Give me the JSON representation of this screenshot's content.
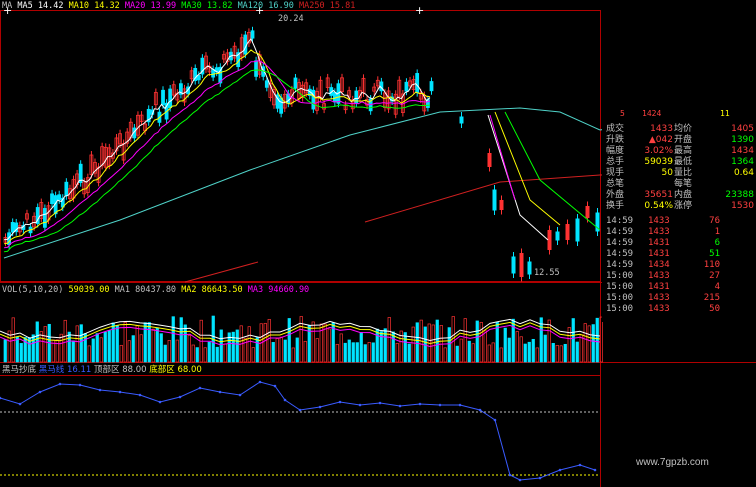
{
  "colors": {
    "background": "#000000",
    "border": "#b00000",
    "up": "#ff3232",
    "down": "#00e4ff",
    "ma5": "#ffffff",
    "ma10": "#ffff00",
    "ma20": "#ff00ff",
    "ma30": "#00ff00",
    "ma120": "#4fd2c8",
    "ma250": "#d02020",
    "label_white": "#c0c0c0",
    "yellow": "#ffff00",
    "red": "#ff4040",
    "green": "#00ff00",
    "blue_line": "#3a5bff"
  },
  "price_panel": {
    "legend": [
      {
        "label": "MA",
        "value": ""
      },
      {
        "label": "MA5",
        "value": "14.42"
      },
      {
        "label": "MA10",
        "value": "14.32"
      },
      {
        "label": "MA20",
        "value": "13.99"
      },
      {
        "label": "MA30",
        "value": "13.82"
      },
      {
        "label": "MA120",
        "value": "16.90"
      },
      {
        "label": "MA250",
        "value": "15.81"
      }
    ],
    "high_label": "20.24",
    "low_label": "12.55"
  },
  "volume_panel": {
    "title": "VOL(5,10,20)",
    "vol": "59039.00",
    "ma1_label": "MA1",
    "ma1": "80437.80",
    "ma2_label": "MA2",
    "ma2": "86643.50",
    "ma3_label": "MA3",
    "ma3": "94660.90"
  },
  "indicator_panel": {
    "name": "黑马抄底",
    "series": "黑马线",
    "series_value": "16.11",
    "top_label": "顶部区",
    "top_value": "88.00",
    "bottom_label": "底部区",
    "bottom_value": "68.00"
  },
  "quote": {
    "partial_top": [
      "5",
      "1424",
      "11"
    ],
    "rows": [
      {
        "l1": "成交",
        "v1": "1433",
        "l2": "均价",
        "v2": "1405"
      },
      {
        "l1": "升跌",
        "v1": "▲042",
        "l2": "开盘",
        "v2": "1390"
      },
      {
        "l1": "幅度",
        "v1": "3.02%",
        "l2": "最高",
        "v2": "1434"
      },
      {
        "l1": "总手",
        "v1": "59039",
        "l2": "最低",
        "v2": "1364"
      },
      {
        "l1": "现手",
        "v1": "50",
        "l2": "量比",
        "v2": "0.64"
      },
      {
        "l1": "总笔",
        "v1": "",
        "l2": "每笔",
        "v2": ""
      },
      {
        "l1": "外盘",
        "v1": "35651",
        "l2": "内盘",
        "v2": "23388"
      },
      {
        "l1": "换手",
        "v1": "0.54%",
        "l2": "涨停",
        "v2": "1530"
      }
    ],
    "ticks": [
      {
        "time": "14:59",
        "price": "1433",
        "vol": "76"
      },
      {
        "time": "14:59",
        "price": "1433",
        "vol": "1"
      },
      {
        "time": "14:59",
        "price": "1431",
        "vol": "6"
      },
      {
        "time": "14:59",
        "price": "1431",
        "vol": "51"
      },
      {
        "time": "14:59",
        "price": "1434",
        "vol": "110"
      },
      {
        "time": "15:00",
        "price": "1433",
        "vol": "27"
      },
      {
        "time": "15:00",
        "price": "1431",
        "vol": "4"
      },
      {
        "time": "15:00",
        "price": "1433",
        "vol": "215"
      },
      {
        "time": "15:00",
        "price": "1433",
        "vol": "50"
      }
    ]
  },
  "watermark": "www.7gpzb.com"
}
